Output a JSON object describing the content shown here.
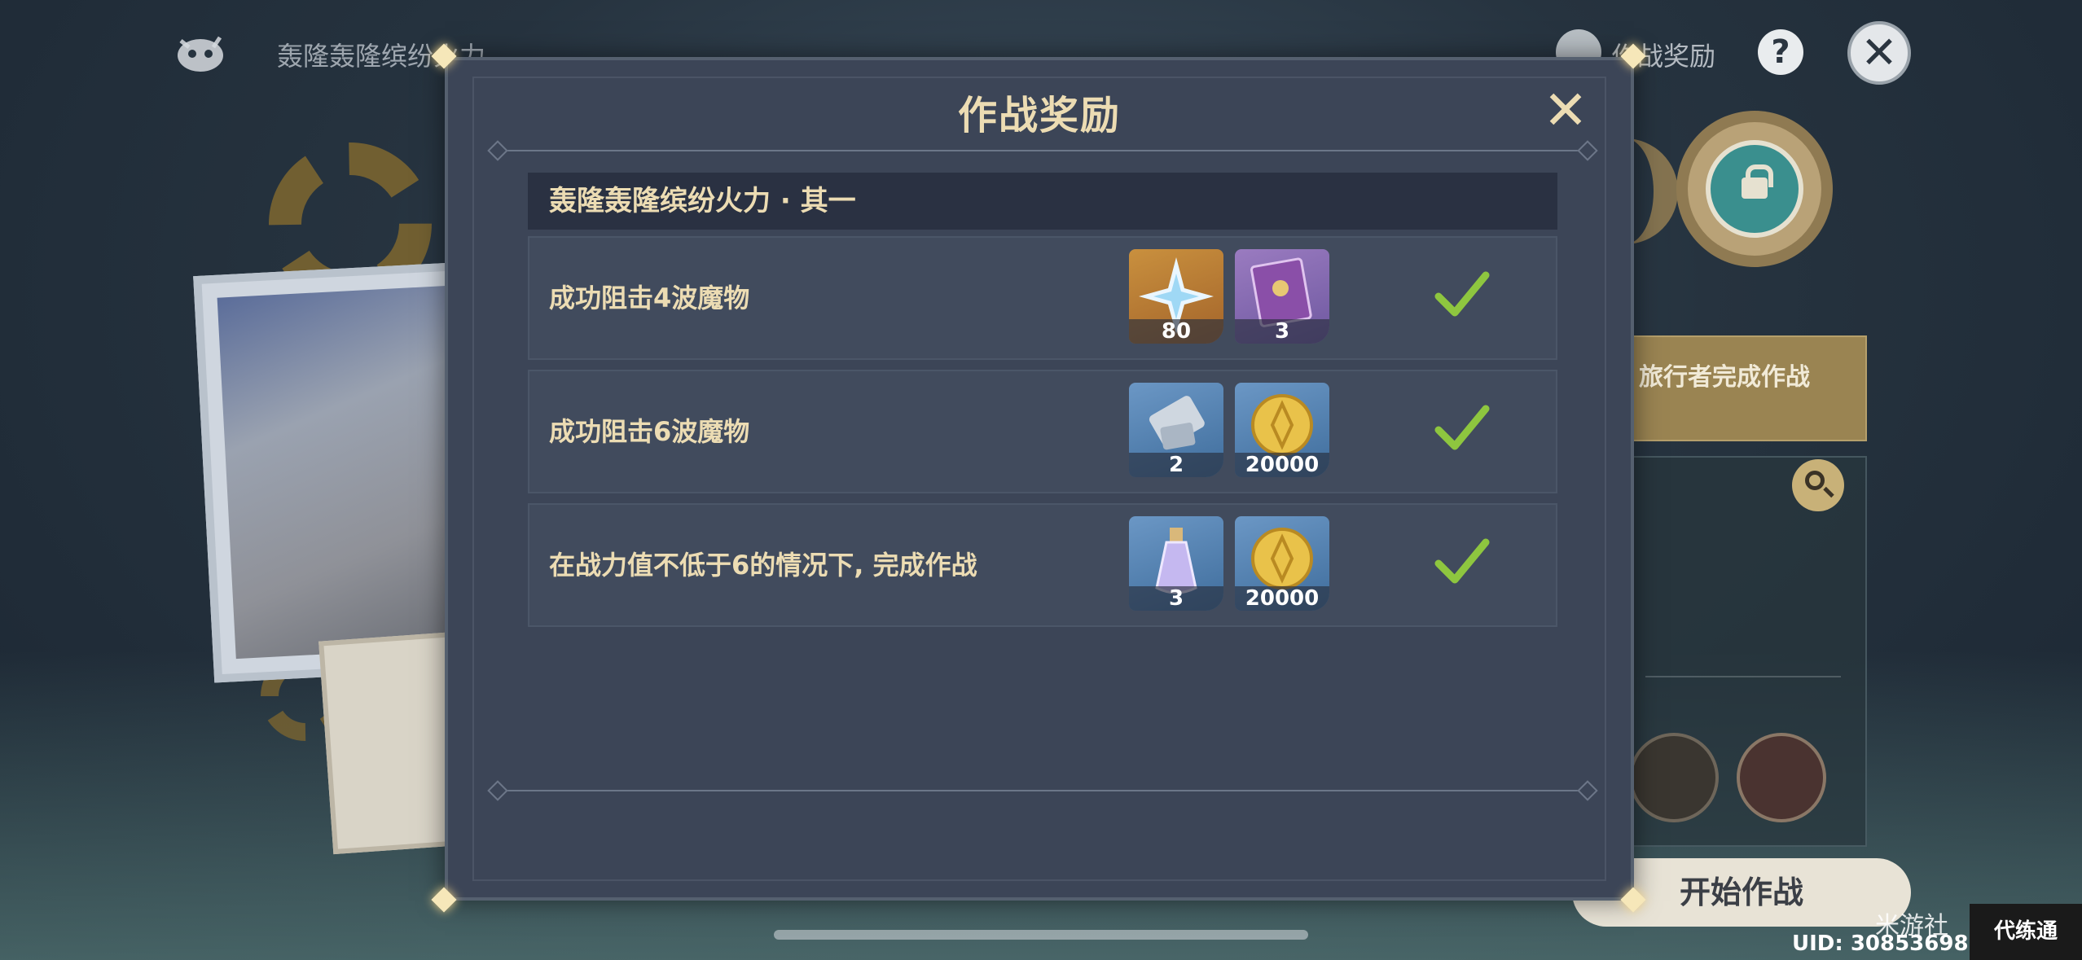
{
  "background": {
    "event_title": "轰隆轰隆缤纷火力",
    "rewards_link": "作战奖励",
    "help_label": "?",
    "close_label": "✕",
    "side_banner": "旅行者完成作战",
    "start_button": "开始作战",
    "uid": "UID: 30853698",
    "watermark": "米游社",
    "wm_brand": "代练通"
  },
  "dialog": {
    "title": "作战奖励",
    "close_label": "✕",
    "section_title": "轰隆轰隆缤纷火力 · 其一",
    "rows": [
      {
        "text": "成功阻击4波魔物",
        "rewards": [
          {
            "icon": "primogem-icon",
            "count": "80",
            "bg": "gold"
          },
          {
            "icon": "book-icon",
            "count": "3",
            "bg": "purple"
          }
        ],
        "completed": true
      },
      {
        "text": "成功阻击6波魔物",
        "rewards": [
          {
            "icon": "scroll-icon",
            "count": "2",
            "bg": "blue"
          },
          {
            "icon": "mora-icon",
            "count": "20000",
            "bg": "blue"
          }
        ],
        "completed": true
      },
      {
        "text": "在战力值不低于6的情况下, 完成作战",
        "rewards": [
          {
            "icon": "potion-icon",
            "count": "3",
            "bg": "blue"
          },
          {
            "icon": "mora-icon",
            "count": "20000",
            "bg": "blue"
          }
        ],
        "completed": true
      }
    ]
  },
  "colors": {
    "accent_text": "#ecdcb3",
    "check_green": "#8ec63f",
    "dialog_bg": "#3c4557"
  }
}
